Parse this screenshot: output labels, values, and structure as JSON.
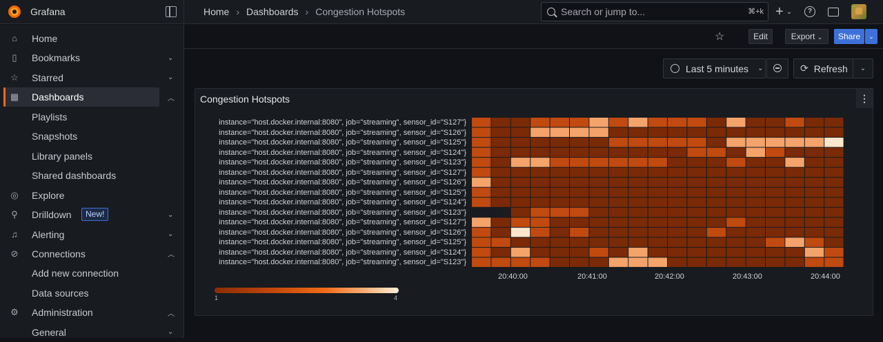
{
  "app": {
    "name": "Grafana"
  },
  "breadcrumb": [
    "Home",
    "Dashboards",
    "Congestion Hotspots"
  ],
  "search": {
    "placeholder": "Search or jump to...",
    "shortcut": "⌘+k"
  },
  "sidebar": {
    "items": [
      {
        "label": "Home",
        "icon": "home-icon"
      },
      {
        "label": "Bookmarks",
        "icon": "bookmark-icon",
        "chevron": "down"
      },
      {
        "label": "Starred",
        "icon": "star-icon",
        "chevron": "down"
      },
      {
        "label": "Dashboards",
        "icon": "grid-icon",
        "chevron": "up",
        "active": true
      },
      {
        "label": "Playlists",
        "sub": true
      },
      {
        "label": "Snapshots",
        "sub": true
      },
      {
        "label": "Library panels",
        "sub": true
      },
      {
        "label": "Shared dashboards",
        "sub": true
      },
      {
        "label": "Explore",
        "icon": "compass-icon"
      },
      {
        "label": "Drilldown",
        "icon": "microscope-icon",
        "chevron": "down",
        "badge": "New!"
      },
      {
        "label": "Alerting",
        "icon": "bell-icon",
        "chevron": "down"
      },
      {
        "label": "Connections",
        "icon": "link-icon",
        "chevron": "up"
      },
      {
        "label": "Add new connection",
        "sub": true
      },
      {
        "label": "Data sources",
        "sub": true
      },
      {
        "label": "Administration",
        "icon": "gear-icon",
        "chevron": "up"
      },
      {
        "label": "General",
        "sub": true,
        "chevron": "down"
      }
    ]
  },
  "toolbar": {
    "edit_label": "Edit",
    "export_label": "Export",
    "share_label": "Share"
  },
  "time": {
    "range_label": "Last 5 minutes",
    "refresh_label": "Refresh"
  },
  "panel": {
    "title": "Congestion Hotspots"
  },
  "chart_data": {
    "type": "heatmap",
    "title": "Congestion Hotspots",
    "rows": [
      "instance=\"host.docker.internal:8080\", job=\"streaming\", sensor_id=\"S127\"}",
      "instance=\"host.docker.internal:8080\", job=\"streaming\", sensor_id=\"S126\"}",
      "instance=\"host.docker.internal:8080\", job=\"streaming\", sensor_id=\"S125\"}",
      "instance=\"host.docker.internal:8080\", job=\"streaming\", sensor_id=\"S124\"}",
      "instance=\"host.docker.internal:8080\", job=\"streaming\", sensor_id=\"S123\"}",
      "instance=\"host.docker.internal:8080\", job=\"streaming\", sensor_id=\"S127\"}",
      "instance=\"host.docker.internal:8080\", job=\"streaming\", sensor_id=\"S126\"}",
      "instance=\"host.docker.internal:8080\", job=\"streaming\", sensor_id=\"S125\"}",
      "instance=\"host.docker.internal:8080\", job=\"streaming\", sensor_id=\"S124\"}",
      "instance=\"host.docker.internal:8080\", job=\"streaming\", sensor_id=\"S123\"}",
      "instance=\"host.docker.internal:8080\", job=\"streaming\", sensor_id=\"S127\"}",
      "instance=\"host.docker.internal:8080\", job=\"streaming\", sensor_id=\"S126\"}",
      "instance=\"host.docker.internal:8080\", job=\"streaming\", sensor_id=\"S125\"}",
      "instance=\"host.docker.internal:8080\", job=\"streaming\", sensor_id=\"S124\"}",
      "instance=\"host.docker.internal:8080\", job=\"streaming\", sensor_id=\"S123\"}"
    ],
    "x_ticks": [
      "20:40:00",
      "20:41:00",
      "20:42:00",
      "20:43:00",
      "20:44:00"
    ],
    "color_scale": {
      "min": 1,
      "max": 4,
      "colors": [
        "#7a2a06",
        "#c04a0f",
        "#f06b19",
        "#fcc48e",
        "#fff0d8"
      ]
    },
    "values": [
      [
        2,
        1,
        1,
        2,
        2,
        2,
        3,
        2,
        3,
        2,
        2,
        2,
        1,
        3,
        1,
        1,
        2,
        1,
        1
      ],
      [
        2,
        1,
        1,
        3,
        3,
        3,
        3,
        1,
        1,
        1,
        1,
        1,
        1,
        1,
        1,
        1,
        1,
        1,
        1
      ],
      [
        2,
        1,
        1,
        1,
        1,
        1,
        1,
        2,
        2,
        2,
        2,
        2,
        1,
        3,
        3,
        3,
        3,
        3,
        4
      ],
      [
        2,
        1,
        1,
        1,
        1,
        1,
        1,
        1,
        1,
        1,
        1,
        2,
        2,
        1,
        3,
        2,
        1,
        1,
        1
      ],
      [
        2,
        1,
        3,
        3,
        2,
        2,
        2,
        2,
        2,
        2,
        1,
        1,
        1,
        2,
        1,
        1,
        3,
        1,
        1
      ],
      [
        2,
        1,
        1,
        1,
        1,
        1,
        1,
        1,
        1,
        1,
        1,
        1,
        1,
        1,
        1,
        1,
        1,
        1,
        1
      ],
      [
        3,
        1,
        1,
        1,
        1,
        1,
        1,
        1,
        1,
        1,
        1,
        1,
        1,
        1,
        1,
        1,
        1,
        1,
        1
      ],
      [
        2,
        1,
        1,
        1,
        1,
        1,
        1,
        1,
        1,
        1,
        1,
        1,
        1,
        1,
        1,
        1,
        1,
        1,
        1
      ],
      [
        2,
        1,
        1,
        1,
        1,
        1,
        1,
        1,
        1,
        1,
        1,
        1,
        1,
        1,
        1,
        1,
        1,
        1,
        1
      ],
      [
        0,
        0,
        1,
        2,
        2,
        2,
        1,
        1,
        1,
        1,
        1,
        1,
        1,
        1,
        1,
        1,
        1,
        1,
        1
      ],
      [
        3,
        1,
        2,
        2,
        1,
        1,
        1,
        1,
        1,
        1,
        1,
        1,
        1,
        2,
        1,
        1,
        1,
        1,
        1
      ],
      [
        2,
        1,
        4,
        2,
        1,
        2,
        1,
        1,
        1,
        1,
        1,
        1,
        2,
        1,
        1,
        1,
        1,
        1,
        1
      ],
      [
        2,
        2,
        1,
        1,
        1,
        1,
        1,
        1,
        1,
        1,
        1,
        1,
        1,
        1,
        1,
        2,
        3,
        2,
        1
      ],
      [
        2,
        1,
        3,
        1,
        1,
        1,
        2,
        1,
        3,
        1,
        1,
        1,
        1,
        1,
        1,
        1,
        1,
        3,
        2
      ],
      [
        2,
        2,
        2,
        2,
        1,
        1,
        1,
        3,
        3,
        3,
        1,
        1,
        1,
        1,
        1,
        1,
        1,
        2,
        2
      ]
    ]
  }
}
